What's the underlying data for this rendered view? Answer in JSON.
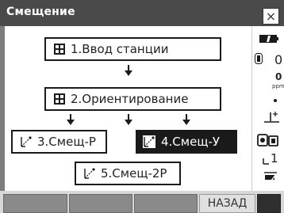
{
  "window": {
    "title": "Смещение",
    "close_symbol": "×"
  },
  "menu": {
    "items": [
      {
        "number_label": "1.Ввод станции",
        "icon": "station-grid-icon"
      },
      {
        "number_label": "2.Ориентирование",
        "icon": "orientation-grid-icon"
      },
      {
        "number_label": "3.Смещ-Р",
        "icon": "offset-distance-icon"
      },
      {
        "number_label": "4.Смещ-У",
        "icon": "offset-angle-icon",
        "selected": true
      },
      {
        "number_label": "5.Смещ-2Р",
        "icon": "offset-two-distance-icon"
      }
    ]
  },
  "sidebar": {
    "battery_icon": "battery-icon",
    "target_value": "0",
    "ppm_value": "0",
    "ppm_unit": "ppm",
    "level_icon": "tilt-level-icon",
    "camera_icon": "camera-icon",
    "page_number": "1",
    "input_icon": "input-mode-icon"
  },
  "softkeys": {
    "key1": "",
    "key2": "",
    "key3": "",
    "key4": "",
    "back_label": "НАЗАД"
  },
  "colors": {
    "title_bg": "#4a4a4a",
    "frame_bg": "#7d7d7d",
    "selected_bg": "#1a1a1a",
    "softkey_bg": "#8a8a8a"
  }
}
